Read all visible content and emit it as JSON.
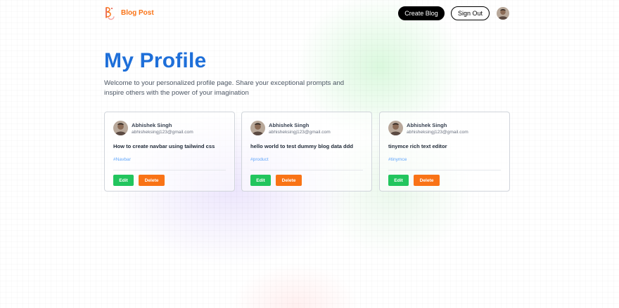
{
  "header": {
    "brand": "Blog Post",
    "logo_icon": "blog-logo-icon",
    "create_label": "Create Blog",
    "signout_label": "Sign Out",
    "avatar_icon": "user-avatar-icon"
  },
  "page": {
    "title": "My Profile",
    "description": "Welcome to your personalized profile page. Share your exceptional prompts and inspire others with the power of your imagination"
  },
  "colors": {
    "accent_blue": "#1e6fd9",
    "brand_orange": "#f97316",
    "edit_green": "#22c55e",
    "delete_orange": "#f97316",
    "tag_blue": "#60a5fa"
  },
  "posts": [
    {
      "author": "Abhishek Singh",
      "email": "abhisheksingj123@gmail.com",
      "title": "How to create navbar using tailwind css",
      "tag": "#Navbar",
      "edit_label": "Edit",
      "delete_label": "Delete"
    },
    {
      "author": "Abhishek Singh",
      "email": "abhisheksingj123@gmail.com",
      "title": "hello world to test dummy blog data ddd",
      "tag": "#product",
      "edit_label": "Edit",
      "delete_label": "Delete"
    },
    {
      "author": "Abhishek Singh",
      "email": "abhisheksingj123@gmail.com",
      "title": "tinymce rich text editor",
      "tag": "#tinymce",
      "edit_label": "Edit",
      "delete_label": "Delete"
    }
  ]
}
